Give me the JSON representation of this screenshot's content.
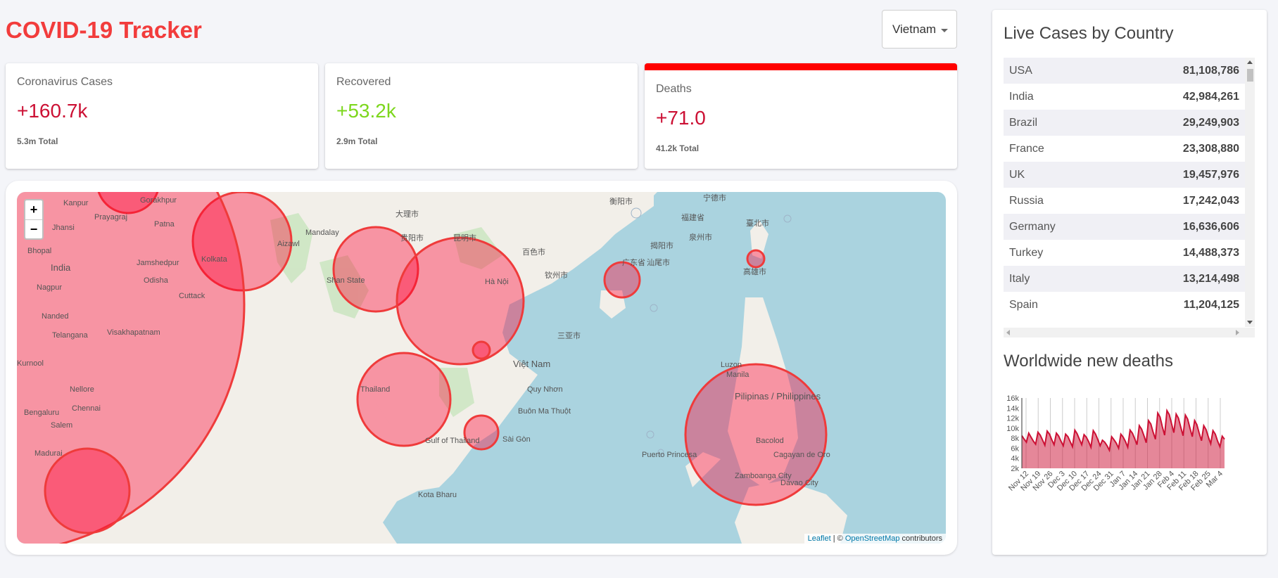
{
  "header": {
    "title": "COVID-19 Tracker"
  },
  "country_select": {
    "selected": "Vietnam"
  },
  "cards": [
    {
      "label": "Coronavirus Cases",
      "value": "+160.7k",
      "total": "5.3m Total"
    },
    {
      "label": "Recovered",
      "value": "+53.2k",
      "total": "2.9m Total"
    },
    {
      "label": "Deaths",
      "value": "+71.0",
      "total": "41.2k Total"
    }
  ],
  "map": {
    "zoom_in": "+",
    "zoom_out": "−",
    "attribution": {
      "leaflet": "Leaflet",
      "sep": " | © ",
      "osm": "OpenStreetMap",
      "suffix": " contributors"
    },
    "labels": [
      "Kanpur",
      "Prayagraj",
      "Patna",
      "Jhansi",
      "Bhopal",
      "India",
      "Kolkata",
      "Jamshedpur",
      "Nagpur",
      "Cuttack",
      "Odisha",
      "Nanded",
      "Visakhapatnam",
      "Telangana",
      "Kurnool",
      "Nellore",
      "Chennai",
      "Bengaluru",
      "Salem",
      "Madurai",
      "Gorakhpur",
      "Aizawl",
      "Mandalay",
      "Shan State",
      "Hà Nội",
      "Thailand",
      "Việt Nam",
      "Quy Nhơn",
      "Buôn Ma Thuột",
      "Sài Gòn",
      "Gulf of Thailand",
      "Luzon",
      "Manila",
      "Pilipinas / Philippines",
      "Bacolod",
      "Puerto Princesa",
      "Cagayan de Oro",
      "Zamboanga City",
      "Davao City",
      "Kota Bharu",
      "臺北市",
      "高雄市",
      "泉州市",
      "福建省",
      "衡阳市",
      "宁德市",
      "大理市",
      "昆明市",
      "贵阳市",
      "广东省",
      "汕尾市",
      "百色市",
      "钦州市",
      "三亚市",
      "揭阳市"
    ]
  },
  "sidebar": {
    "live_title": "Live Cases by Country",
    "rows": [
      {
        "country": "USA",
        "cases": "81,108,786"
      },
      {
        "country": "India",
        "cases": "42,984,261"
      },
      {
        "country": "Brazil",
        "cases": "29,249,903"
      },
      {
        "country": "France",
        "cases": "23,308,880"
      },
      {
        "country": "UK",
        "cases": "19,457,976"
      },
      {
        "country": "Russia",
        "cases": "17,242,043"
      },
      {
        "country": "Germany",
        "cases": "16,636,606"
      },
      {
        "country": "Turkey",
        "cases": "14,488,373"
      },
      {
        "country": "Italy",
        "cases": "13,214,498"
      },
      {
        "country": "Spain",
        "cases": "11,204,125"
      }
    ],
    "chart_title": "Worldwide new deaths"
  },
  "colors": {
    "title": "#f23c3c",
    "cases": "#cc1034",
    "recovered": "#7dd71d",
    "circle": "#f03",
    "line": "#cc1034",
    "fill": "rgba(204,16,52,0.5)"
  },
  "chart_data": {
    "type": "area",
    "title": "Worldwide new deaths",
    "xlabel": "",
    "ylabel": "",
    "ylim": [
      2000,
      16000
    ],
    "y_ticks": [
      "2k",
      "4k",
      "6k",
      "8k",
      "10k",
      "12k",
      "14k",
      "16k"
    ],
    "x_ticks": [
      "Nov 12",
      "Nov 19",
      "Nov 26",
      "Dec 3",
      "Dec 10",
      "Dec 17",
      "Dec 24",
      "Dec 31",
      "Jan 7",
      "Jan 14",
      "Jan 21",
      "Jan 28",
      "Feb 4",
      "Feb 11",
      "Feb 18",
      "Feb 25",
      "Mar 4"
    ],
    "values": [
      8500,
      7800,
      7200,
      9000,
      8200,
      7400,
      6800,
      9200,
      8600,
      7600,
      6600,
      9400,
      8800,
      7700,
      6700,
      9000,
      8400,
      7400,
      6500,
      8800,
      8300,
      7300,
      6300,
      9600,
      8900,
      7800,
      6700,
      8700,
      8200,
      7300,
      6200,
      9500,
      8800,
      7700,
      6500,
      7600,
      7200,
      6500,
      5600,
      8300,
      7700,
      7000,
      6000,
      8800,
      8200,
      7300,
      6200,
      9600,
      9000,
      7900,
      6700,
      10500,
      9800,
      8500,
      7100,
      11500,
      10800,
      9200,
      7800,
      13000,
      12200,
      10300,
      8600,
      13500,
      12700,
      10900,
      9100,
      12800,
      12000,
      10200,
      8500,
      12600,
      11800,
      10000,
      8300,
      11500,
      10700,
      9000,
      7500,
      10500,
      9700,
      8200,
      6900,
      9500,
      8800,
      7400,
      6300,
      8400,
      7800
    ]
  }
}
